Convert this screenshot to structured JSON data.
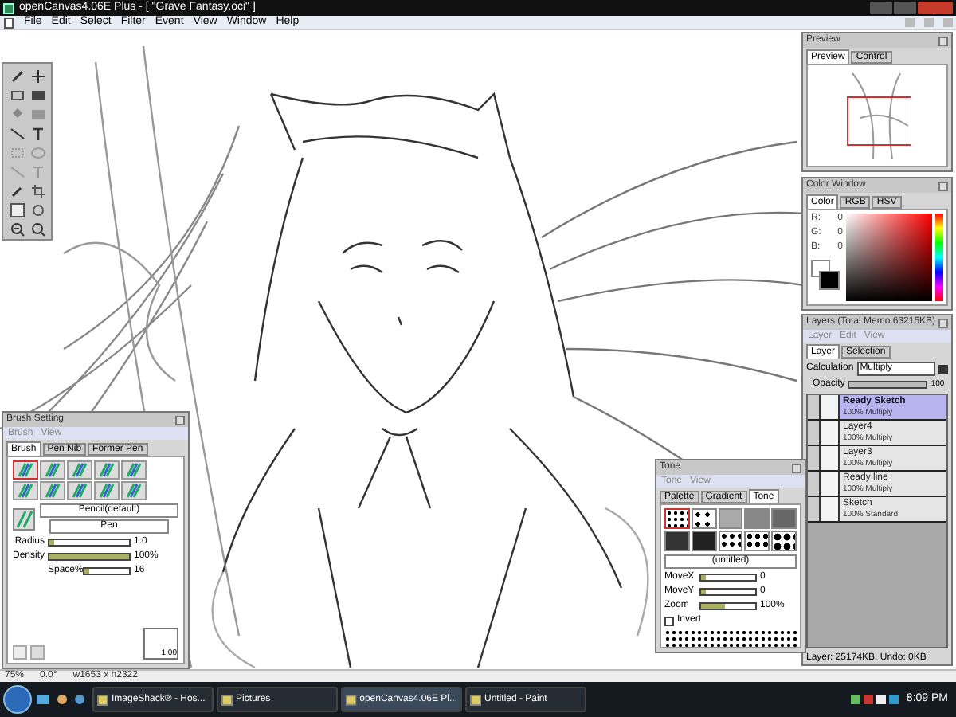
{
  "window": {
    "title": "openCanvas4.06E Plus - [ \"Grave Fantasy.oci\" ]"
  },
  "menu": [
    "File",
    "Edit",
    "Select",
    "Filter",
    "Event",
    "View",
    "Window",
    "Help"
  ],
  "preview": {
    "title": "Preview",
    "tabs": [
      {
        "label": "Preview",
        "selected": true
      },
      {
        "label": "Control",
        "selected": false
      }
    ]
  },
  "color_window": {
    "title": "Color Window",
    "tabs": [
      {
        "label": "Color",
        "selected": true
      },
      {
        "label": "RGB",
        "selected": false
      },
      {
        "label": "HSV",
        "selected": false
      }
    ],
    "readouts": [
      {
        "label": "R:",
        "value": "0"
      },
      {
        "label": "G:",
        "value": "0"
      },
      {
        "label": "B:",
        "value": "0"
      }
    ]
  },
  "layers": {
    "title": "Layers (Total Memo 63215KB)",
    "menu": [
      "Layer",
      "Edit",
      "View"
    ],
    "tabs": [
      {
        "label": "Layer",
        "selected": true
      },
      {
        "label": "Selection",
        "selected": false
      }
    ],
    "calculation": {
      "label": "Calculation",
      "value": "Multiply"
    },
    "opacity": {
      "label": "Opacity",
      "level": 1,
      "reading": "100"
    },
    "items": [
      {
        "name": "Ready Sketch",
        "mode": "100% Multiply",
        "selected": true
      },
      {
        "name": "Layer4",
        "mode": "100% Multiply",
        "selected": false
      },
      {
        "name": "Layer3",
        "mode": "100% Multiply",
        "selected": false
      },
      {
        "name": "Ready line",
        "mode": "100% Multiply",
        "selected": false
      },
      {
        "name": "Sketch",
        "mode": "100% Standard",
        "selected": false
      }
    ],
    "status": "Layer: 25174KB, Undo: 0KB"
  },
  "brush_setting": {
    "title": "Brush Setting",
    "menu": [
      "Brush",
      "View"
    ],
    "tabs": [
      {
        "label": "Brush",
        "selected": true
      },
      {
        "label": "Pen Nib",
        "selected": false
      },
      {
        "label": "Former Pen",
        "selected": false
      }
    ],
    "presets": [
      {
        "selected": true
      },
      {
        "selected": false
      },
      {
        "selected": false
      },
      {
        "selected": false
      },
      {
        "selected": false
      },
      {
        "selected": false
      },
      {
        "selected": false
      },
      {
        "selected": false
      },
      {
        "selected": false
      },
      {
        "selected": false
      }
    ],
    "brush_name": "Pencil(default)",
    "brush_type": "Pen",
    "sliders": [
      {
        "label": "Radius",
        "level": 0.05,
        "reading": "1.0"
      },
      {
        "label": "Density",
        "level": 1,
        "reading": "100%"
      },
      {
        "label": "Space%",
        "level": 0.1,
        "reading": "16"
      }
    ],
    "curve_value": "1.00"
  },
  "tone": {
    "title": "Tone",
    "menu": [
      "Tone",
      "View"
    ],
    "tabs": [
      {
        "label": "Palette",
        "selected": false
      },
      {
        "label": "Gradient",
        "selected": false
      },
      {
        "label": "Tone",
        "selected": true
      }
    ],
    "patterns": [
      {
        "selected": true
      },
      {
        "selected": false
      },
      {
        "selected": false
      },
      {
        "selected": false
      },
      {
        "selected": false
      },
      {
        "selected": false
      },
      {
        "selected": false
      },
      {
        "selected": false
      },
      {
        "selected": false
      },
      {
        "selected": false
      }
    ],
    "pattern_name": "(untitled)",
    "sliders": [
      {
        "label": "MoveX",
        "level": 0,
        "reading": "0"
      },
      {
        "label": "MoveY",
        "level": 0,
        "reading": "0"
      },
      {
        "label": "Zoom",
        "level": 0.45,
        "reading": "100%"
      }
    ],
    "invert": {
      "label": "Invert",
      "checked": false
    }
  },
  "status_bar": [
    "75%",
    "0.0°",
    "w1653 x h2322"
  ],
  "taskbar": {
    "items": [
      {
        "label": "ImageShack® - Hos...",
        "selected": false
      },
      {
        "label": "Pictures",
        "selected": false
      },
      {
        "label": "openCanvas4.06E Pl...",
        "selected": true
      },
      {
        "label": "Untitled - Paint",
        "selected": false
      }
    ],
    "clock": "8:09 PM"
  }
}
